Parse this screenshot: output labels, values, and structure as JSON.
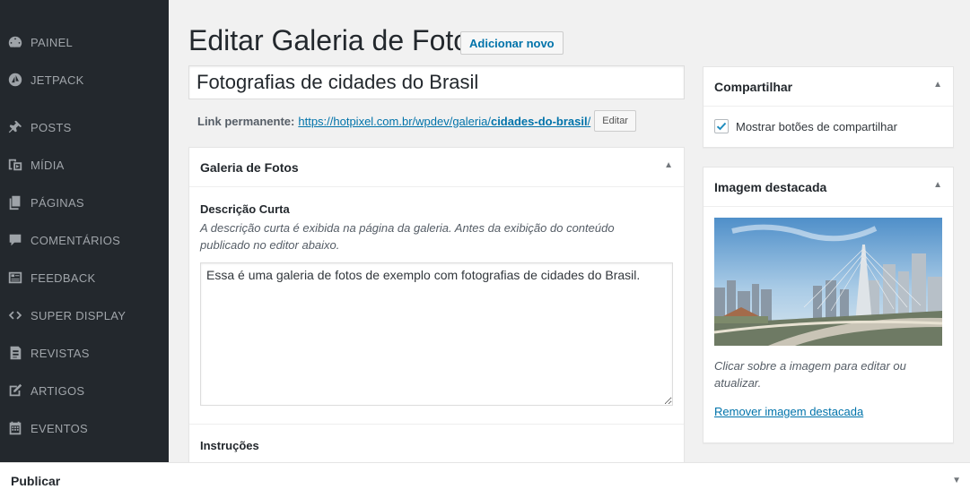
{
  "sidebar": {
    "items": [
      {
        "label": "PAINEL",
        "icon": "dashboard-icon"
      },
      {
        "label": "JETPACK",
        "icon": "jetpack-icon"
      },
      {
        "label": "POSTS",
        "icon": "pin-icon"
      },
      {
        "label": "MÍDIA",
        "icon": "media-icon"
      },
      {
        "label": "PÁGINAS",
        "icon": "pages-icon"
      },
      {
        "label": "COMENTÁRIOS",
        "icon": "comments-icon"
      },
      {
        "label": "FEEDBACK",
        "icon": "feedback-icon"
      },
      {
        "label": "SUPER DISPLAY",
        "icon": "code-icon"
      },
      {
        "label": "REVISTAS",
        "icon": "book-icon"
      },
      {
        "label": "ARTIGOS",
        "icon": "edit-icon"
      },
      {
        "label": "EVENTOS",
        "icon": "calendar-icon"
      }
    ]
  },
  "header": {
    "title": "Editar Galeria de Foto",
    "add_new_label": "Adicionar novo"
  },
  "post": {
    "title_value": "Fotografias de cidades do Brasil",
    "permalink_label": "Link permanente:",
    "permalink_base": "https://hotpixel.com.br/wpdev/galeria/",
    "permalink_slug": "cidades-do-brasil",
    "permalink_trail": "/",
    "edit_label": "Editar"
  },
  "gallery_box": {
    "title": "Galeria de Fotos",
    "short_desc_label": "Descrição Curta",
    "short_desc_help": "A descrição curta é exibida na página da galeria. Antes da exibição do conteúdo publicado no editor abaixo.",
    "short_desc_value": "Essa é uma galeria de fotos de exemplo com fotografias de cidades do Brasil.",
    "instructions_label": "Instruções"
  },
  "share_box": {
    "title": "Compartilhar",
    "checkbox_label": "Mostrar botões de compartilhar",
    "checked": true
  },
  "image_box": {
    "title": "Imagem destacada",
    "help": "Clicar sobre a imagem para editar ou atualizar.",
    "remove_label": "Remover imagem destacada"
  },
  "publish": {
    "title": "Publicar"
  },
  "colors": {
    "sidebar_bg": "#23282d",
    "link": "#0073aa",
    "checkbox_check": "#1e8cbe"
  }
}
